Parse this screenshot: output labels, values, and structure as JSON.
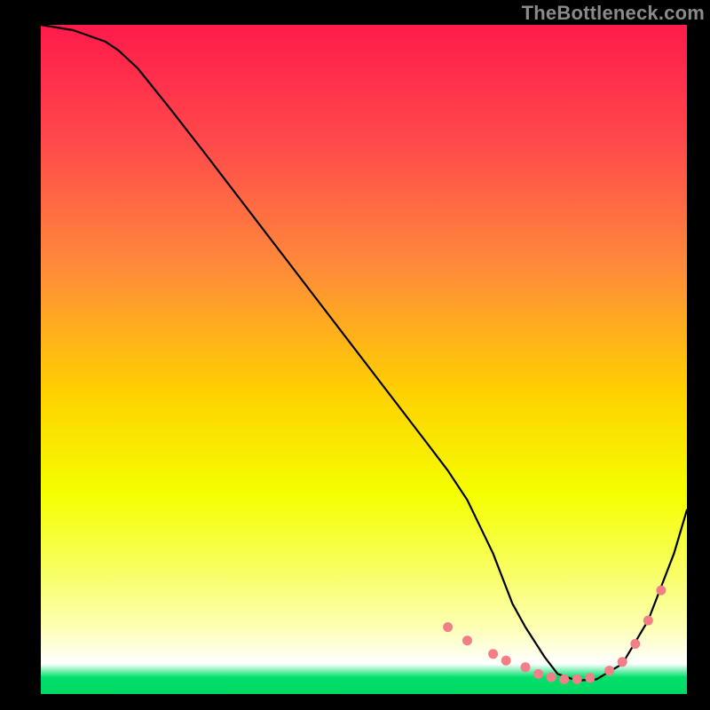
{
  "watermark": "TheBottleneck.com",
  "chart_data": {
    "type": "line",
    "title": "",
    "xlabel": "",
    "ylabel": "",
    "xlim": [
      0,
      100
    ],
    "ylim": [
      0,
      100
    ],
    "grid": false,
    "legend": false,
    "background": {
      "type": "vertical-gradient",
      "stops": [
        {
          "offset": 0.0,
          "color": "#ff1a4b"
        },
        {
          "offset": 0.18,
          "color": "#ff4b4b"
        },
        {
          "offset": 0.36,
          "color": "#ff8a3a"
        },
        {
          "offset": 0.55,
          "color": "#ffd100"
        },
        {
          "offset": 0.7,
          "color": "#f4ff00"
        },
        {
          "offset": 0.82,
          "color": "#f8ff66"
        },
        {
          "offset": 0.9,
          "color": "#fdffb3"
        },
        {
          "offset": 0.955,
          "color": "#ffffff"
        },
        {
          "offset": 0.975,
          "color": "#00e06b"
        },
        {
          "offset": 1.0,
          "color": "#00d860"
        }
      ]
    },
    "series": [
      {
        "name": "bottleneck-curve",
        "color": "#000000",
        "x": [
          0,
          5,
          10,
          12,
          15,
          20,
          25,
          30,
          35,
          40,
          45,
          50,
          55,
          60,
          63,
          66,
          70,
          73,
          75,
          78,
          80,
          83,
          86,
          90,
          94,
          98,
          100
        ],
        "y": [
          100,
          99.2,
          97.5,
          96.2,
          93.5,
          87.5,
          81.3,
          75.0,
          68.7,
          62.4,
          56.1,
          49.8,
          43.5,
          37.2,
          33.4,
          29.0,
          21.0,
          13.5,
          10.0,
          5.5,
          3.0,
          2.0,
          2.2,
          4.5,
          11.0,
          21.0,
          27.5
        ]
      },
      {
        "name": "highlight-dots",
        "color": "#f27f87",
        "x": [
          63,
          66,
          70,
          72,
          75,
          77,
          79,
          81,
          83,
          85,
          88,
          90,
          92,
          94,
          96
        ],
        "y": [
          10,
          8,
          6,
          5,
          4,
          3,
          2.5,
          2.2,
          2.2,
          2.4,
          3.5,
          4.8,
          7.5,
          11.0,
          15.5
        ]
      }
    ],
    "annotations": []
  }
}
